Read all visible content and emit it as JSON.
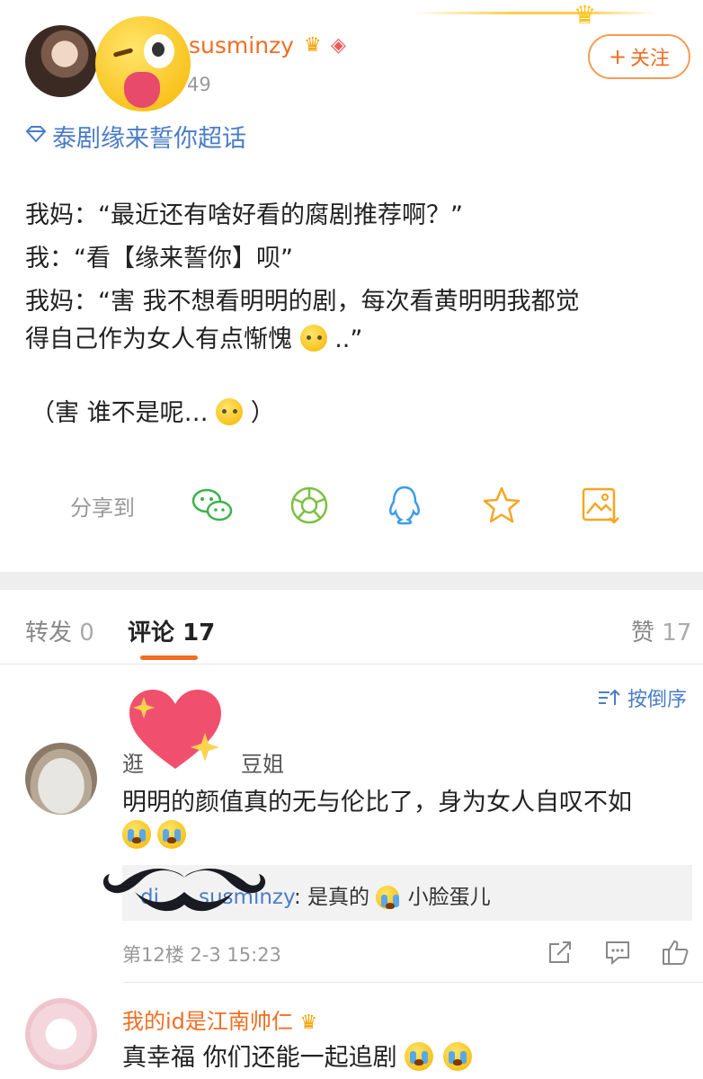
{
  "post": {
    "username": "susminzy",
    "time_fragment": "49",
    "follow_label": "关注",
    "follow_plus": "+",
    "topic": "泰剧缘来誓你超话",
    "lines": [
      "我妈：“最近还有啥好看的腐剧推荐啊？”",
      "我：“看【缘来誓你】呗”",
      "我妈：“害 我不想看明明的剧，每次看黄明明我都觉",
      "得自己作为女人有点惭愧",
      "..”",
      "（害 谁不是呢…",
      "）"
    ],
    "icons": {
      "badge_vip": "crown-badge-icon",
      "badge_level": "diamond-badge-icon",
      "topic_icon": "gem-icon"
    }
  },
  "share": {
    "label": "分享到",
    "targets": [
      "wechat-icon",
      "moments-icon",
      "qq-icon",
      "favorite-star-icon",
      "save-image-icon"
    ]
  },
  "tabs": {
    "repost_label": "转发",
    "repost_count": "0",
    "comment_label": "评论",
    "comment_count": "17",
    "like_label": "赞",
    "like_count": "17"
  },
  "sort_label": "按倒序",
  "comments": [
    {
      "name_start": "逛",
      "name_end": "豆姐",
      "text": "明明的颜值真的无与伦比了，身为女人自叹不如",
      "reply_user_start": "di",
      "reply_user_end": "susminzy",
      "reply_colon": ":",
      "reply_text_a": "是真的",
      "reply_text_b": "小脸蛋儿",
      "floor": "第12楼",
      "time": "2-3 15:23"
    },
    {
      "name": "我的id是江南帅仁",
      "text": "真幸福 你们还能一起追剧"
    }
  ],
  "colors": {
    "accent_orange": "#f26d21",
    "link_blue": "#4a7cc8",
    "muted_gray": "#999999"
  }
}
